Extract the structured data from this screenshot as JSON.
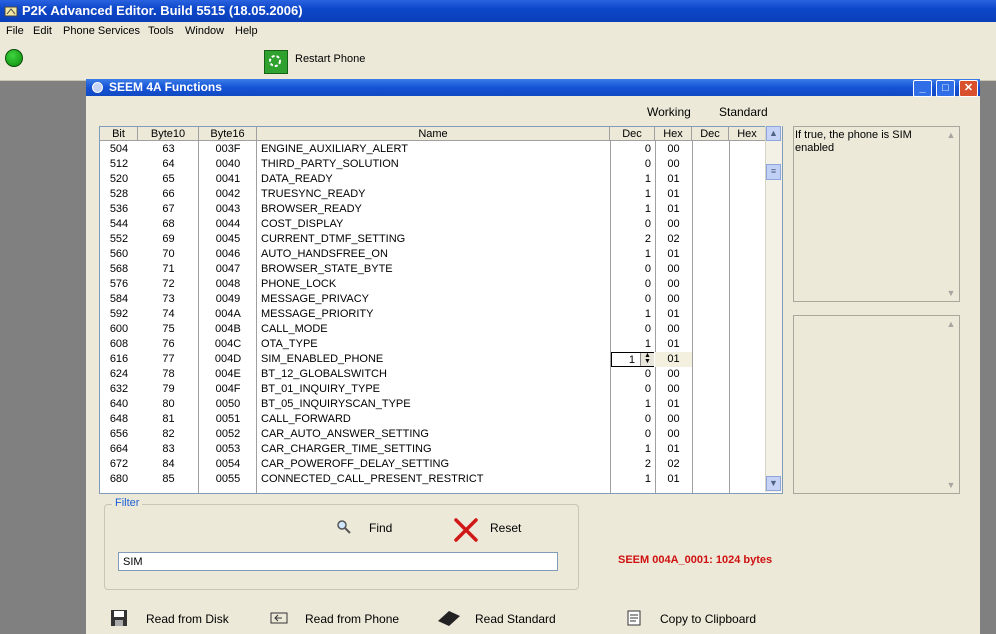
{
  "app": {
    "title": "P2K Advanced Editor. Build 5515 (18.05.2006)"
  },
  "menu": [
    "File",
    "Edit",
    "Phone Services",
    "Tools",
    "Window",
    "Help"
  ],
  "toolbar": {
    "restart_label": "Restart Phone"
  },
  "window": {
    "title": "SEEM 4A Functions"
  },
  "column_groups": {
    "working": "Working",
    "standard": "Standard"
  },
  "columns": [
    "Bit",
    "Byte10",
    "Byte16",
    "Name",
    "Dec",
    "Hex",
    "Dec",
    "Hex"
  ],
  "rows": [
    {
      "bit": "504",
      "byte10": "63",
      "byte16": "003F",
      "name": "ENGINE_AUXILIARY_ALERT",
      "dec": "0",
      "hex": "00"
    },
    {
      "bit": "512",
      "byte10": "64",
      "byte16": "0040",
      "name": "THIRD_PARTY_SOLUTION",
      "dec": "0",
      "hex": "00"
    },
    {
      "bit": "520",
      "byte10": "65",
      "byte16": "0041",
      "name": "DATA_READY",
      "dec": "1",
      "hex": "01"
    },
    {
      "bit": "528",
      "byte10": "66",
      "byte16": "0042",
      "name": "TRUESYNC_READY",
      "dec": "1",
      "hex": "01"
    },
    {
      "bit": "536",
      "byte10": "67",
      "byte16": "0043",
      "name": "BROWSER_READY",
      "dec": "1",
      "hex": "01"
    },
    {
      "bit": "544",
      "byte10": "68",
      "byte16": "0044",
      "name": "COST_DISPLAY",
      "dec": "0",
      "hex": "00"
    },
    {
      "bit": "552",
      "byte10": "69",
      "byte16": "0045",
      "name": "CURRENT_DTMF_SETTING",
      "dec": "2",
      "hex": "02"
    },
    {
      "bit": "560",
      "byte10": "70",
      "byte16": "0046",
      "name": "AUTO_HANDSFREE_ON",
      "dec": "1",
      "hex": "01"
    },
    {
      "bit": "568",
      "byte10": "71",
      "byte16": "0047",
      "name": "BROWSER_STATE_BYTE",
      "dec": "0",
      "hex": "00"
    },
    {
      "bit": "576",
      "byte10": "72",
      "byte16": "0048",
      "name": "PHONE_LOCK",
      "dec": "0",
      "hex": "00"
    },
    {
      "bit": "584",
      "byte10": "73",
      "byte16": "0049",
      "name": "MESSAGE_PRIVACY",
      "dec": "0",
      "hex": "00"
    },
    {
      "bit": "592",
      "byte10": "74",
      "byte16": "004A",
      "name": "MESSAGE_PRIORITY",
      "dec": "1",
      "hex": "01"
    },
    {
      "bit": "600",
      "byte10": "75",
      "byte16": "004B",
      "name": "CALL_MODE",
      "dec": "0",
      "hex": "00"
    },
    {
      "bit": "608",
      "byte10": "76",
      "byte16": "004C",
      "name": "OTA_TYPE",
      "dec": "1",
      "hex": "01"
    },
    {
      "bit": "616",
      "byte10": "77",
      "byte16": "004D",
      "name": "SIM_ENABLED_PHONE",
      "dec": "1",
      "hex": "01",
      "selected": true
    },
    {
      "bit": "624",
      "byte10": "78",
      "byte16": "004E",
      "name": "BT_12_GLOBALSWITCH",
      "dec": "0",
      "hex": "00"
    },
    {
      "bit": "632",
      "byte10": "79",
      "byte16": "004F",
      "name": "BT_01_INQUIRY_TYPE",
      "dec": "0",
      "hex": "00"
    },
    {
      "bit": "640",
      "byte10": "80",
      "byte16": "0050",
      "name": "BT_05_INQUIRYSCAN_TYPE",
      "dec": "1",
      "hex": "01"
    },
    {
      "bit": "648",
      "byte10": "81",
      "byte16": "0051",
      "name": "CALL_FORWARD",
      "dec": "0",
      "hex": "00"
    },
    {
      "bit": "656",
      "byte10": "82",
      "byte16": "0052",
      "name": "CAR_AUTO_ANSWER_SETTING",
      "dec": "0",
      "hex": "00"
    },
    {
      "bit": "664",
      "byte10": "83",
      "byte16": "0053",
      "name": "CAR_CHARGER_TIME_SETTING",
      "dec": "1",
      "hex": "01"
    },
    {
      "bit": "672",
      "byte10": "84",
      "byte16": "0054",
      "name": "CAR_POWEROFF_DELAY_SETTING",
      "dec": "2",
      "hex": "02"
    },
    {
      "bit": "680",
      "byte10": "85",
      "byte16": "0055",
      "name": "CONNECTED_CALL_PRESENT_RESTRICT",
      "dec": "1",
      "hex": "01"
    }
  ],
  "description": "If true, the phone is SIM enabled",
  "filter": {
    "label": "Filter",
    "value": "SIM",
    "find_label": "Find",
    "reset_label": "Reset"
  },
  "seem_info": "SEEM 004A_0001: 1024 bytes",
  "bottom_buttons": [
    "Read from Disk",
    "Read from Phone",
    "Read Standard",
    "Copy to Clipboard"
  ],
  "colors": {
    "title_bar": "#0d47c9",
    "info_red": "#d01010",
    "filter_blue": "#1a5fd6"
  }
}
